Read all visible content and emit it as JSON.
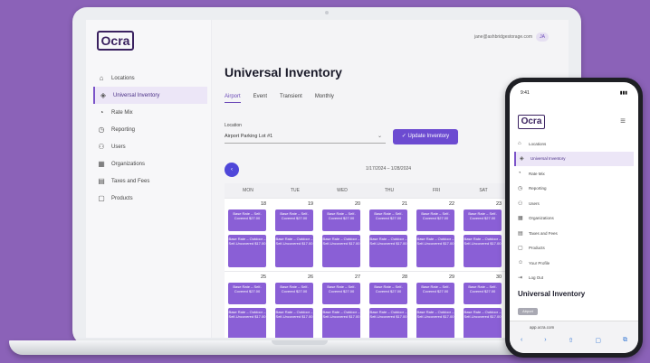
{
  "app": {
    "logo": "Ocra",
    "user_email": "jane@ashbridgestorage.com",
    "user_initials": "JA"
  },
  "sidebar": {
    "items": [
      {
        "label": "Locations",
        "icon": "home-icon"
      },
      {
        "label": "Universal Inventory",
        "icon": "inventory-icon"
      },
      {
        "label": "Rate Mix",
        "icon": "chart-icon"
      },
      {
        "label": "Reporting",
        "icon": "report-icon"
      },
      {
        "label": "Users",
        "icon": "users-icon"
      },
      {
        "label": "Organizations",
        "icon": "building-icon"
      },
      {
        "label": "Taxes and Fees",
        "icon": "receipt-icon"
      },
      {
        "label": "Products",
        "icon": "box-icon"
      }
    ]
  },
  "main": {
    "title": "Universal Inventory",
    "tabs": [
      "Airport",
      "Event",
      "Transient",
      "Monthly"
    ],
    "location_label": "Location",
    "location_value": "Airport Parking Lot #1",
    "update_button": "✓ Update Inventory",
    "date_range": "1/17/2024 – 1/28/2024",
    "prev_button": "‹"
  },
  "calendar": {
    "days": [
      "MON",
      "TUE",
      "WED",
      "THU",
      "FRI",
      "SAT"
    ],
    "week1_numbers": [
      "18",
      "19",
      "20",
      "21",
      "22",
      "23"
    ],
    "week2_numbers": [
      "25",
      "26",
      "27",
      "28",
      "29",
      "30"
    ],
    "cell_a": "Base Rate – Self-Covered $27.00",
    "cell_b": "Base Rate – Outdoor – Self-Uncovered $17.00",
    "cell_fill_color": "#8a5fd6"
  },
  "phone": {
    "time": "9:41",
    "signal": "▮▮▮",
    "logo": "Ocra",
    "menu_icon": "≡",
    "nav": [
      "Locations",
      "Universal Inventory",
      "Rate Mix",
      "Reporting",
      "Users",
      "Organizations",
      "Taxes and Fees",
      "Products",
      "Your Profile",
      "Log Out"
    ],
    "title": "Universal Inventory",
    "tab": "Airport",
    "url": "app.ocra.com",
    "toolbar": [
      "‹",
      "›",
      "⇧",
      "▢",
      "⧉"
    ]
  }
}
